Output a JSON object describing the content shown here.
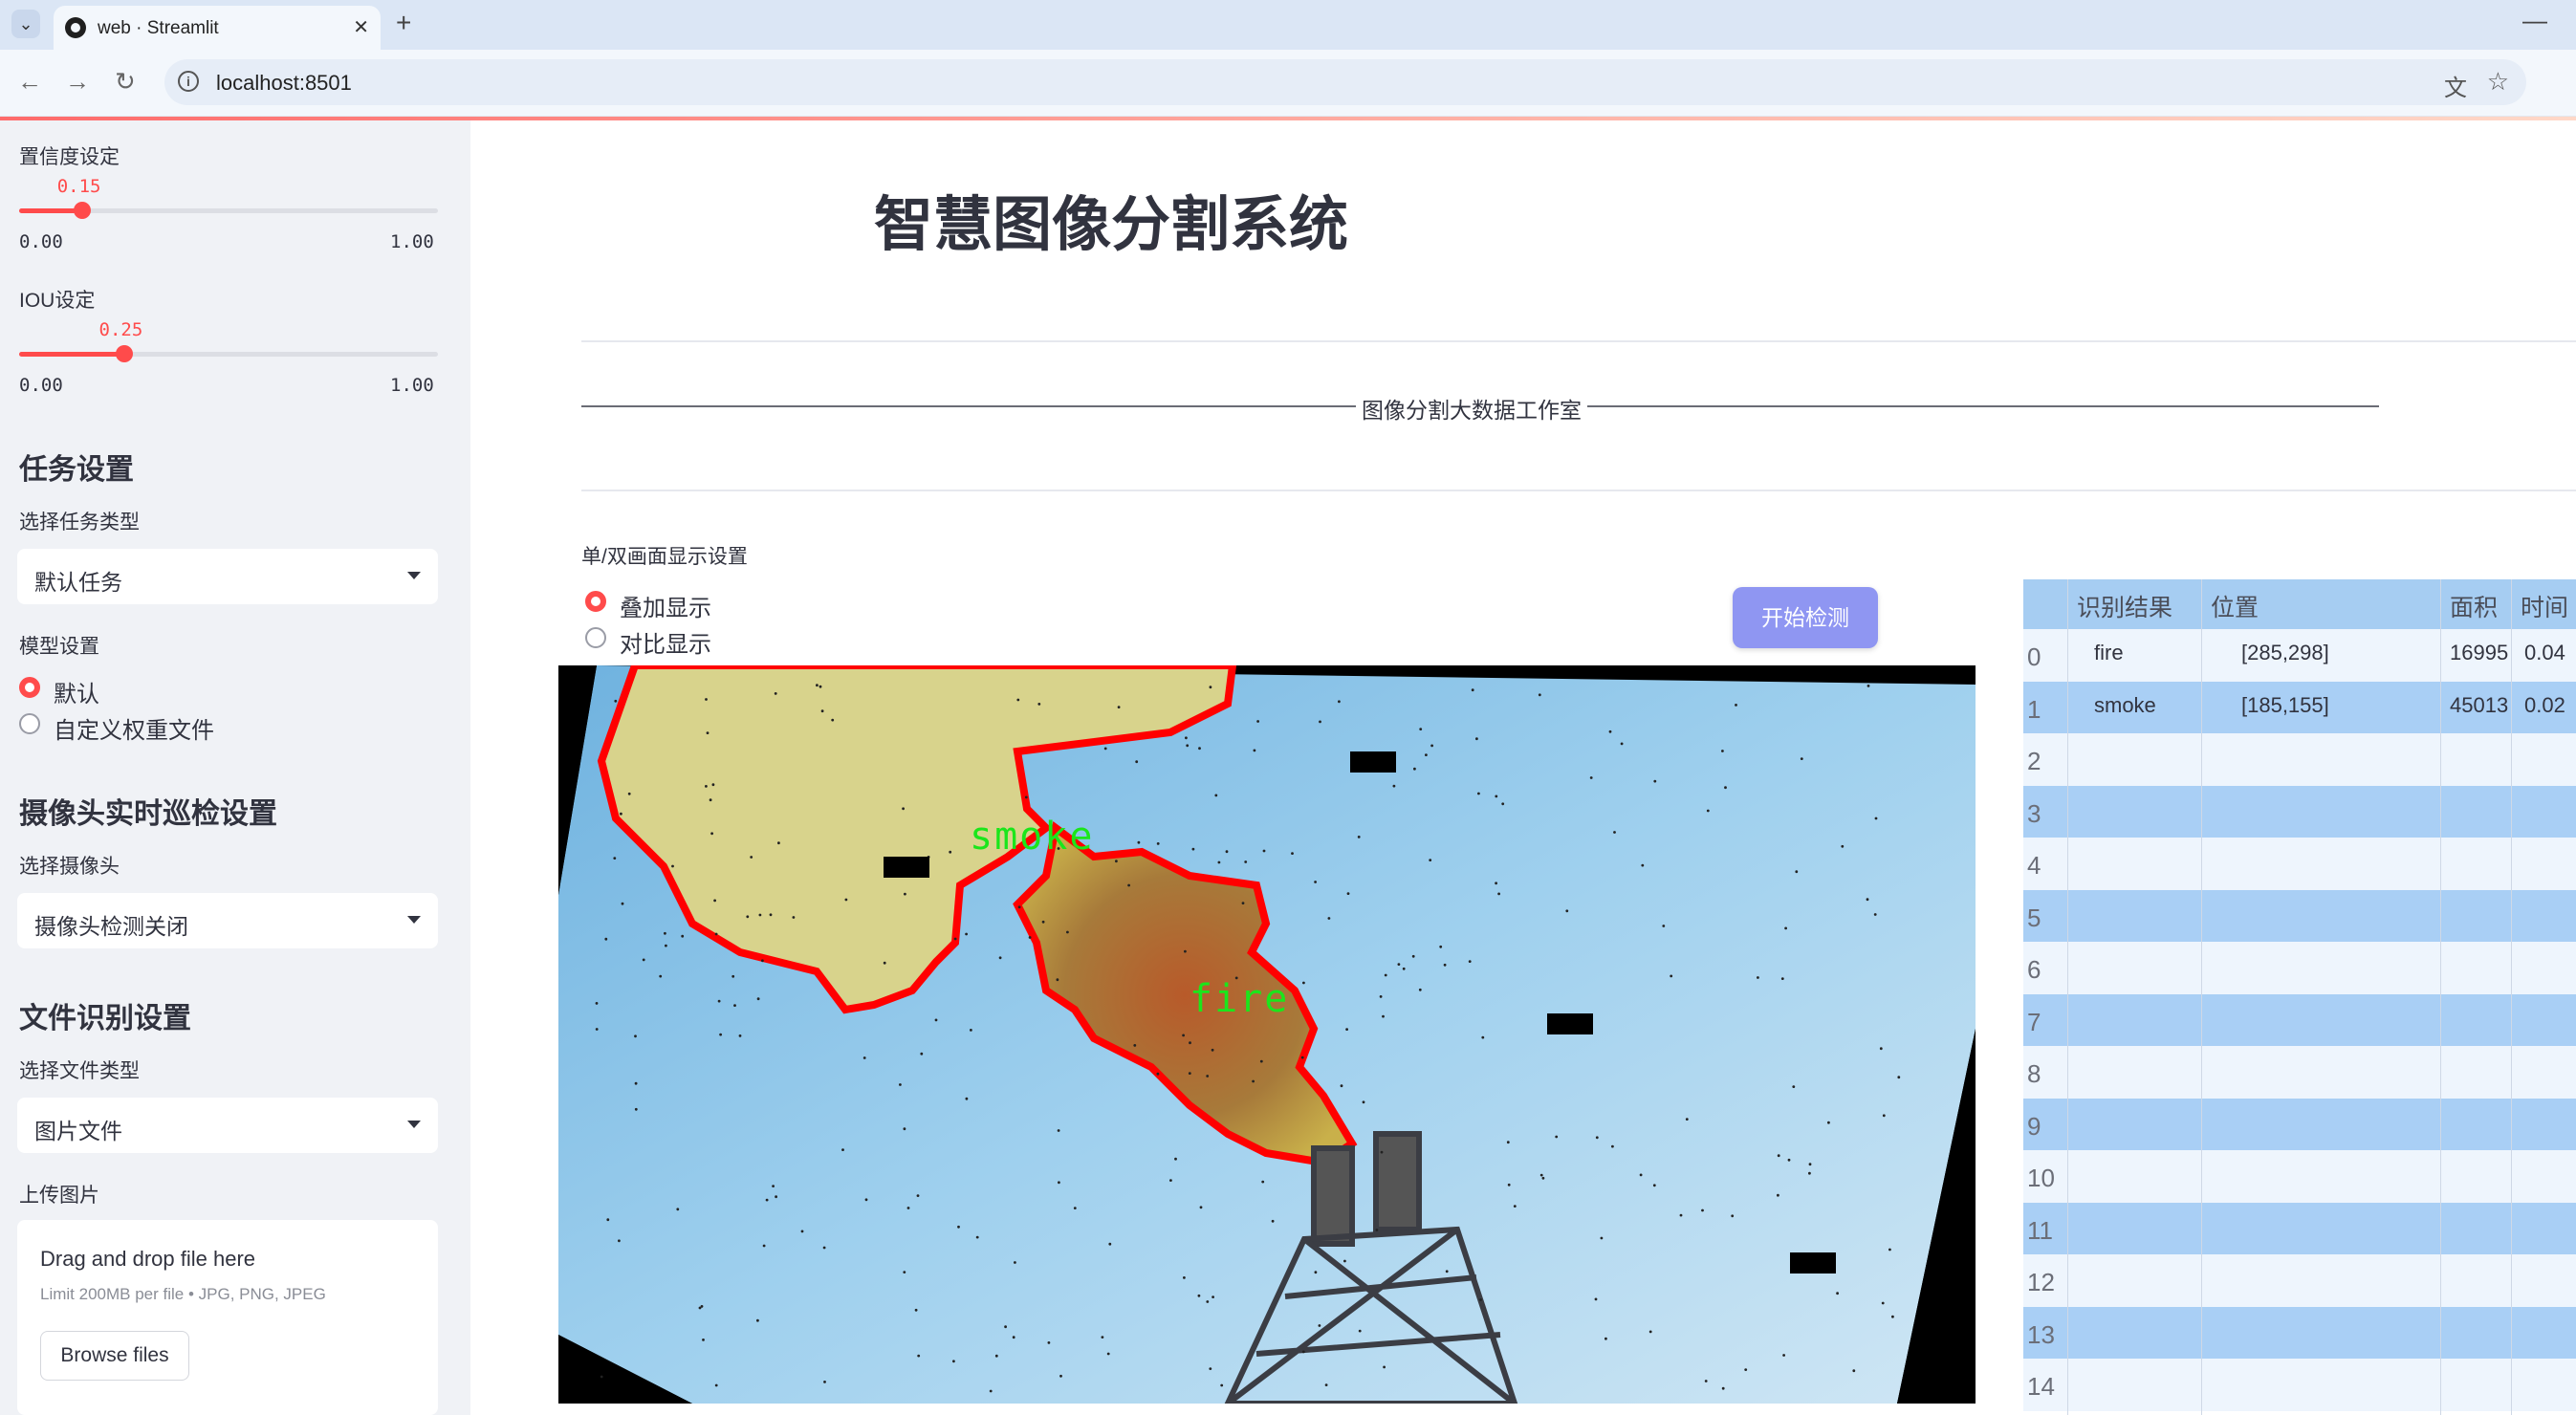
{
  "browser": {
    "tab_title": "web · Streamlit",
    "url": "localhost:8501",
    "new_tab": "+",
    "close": "✕",
    "minimize": "—"
  },
  "sidebar": {
    "confidence": {
      "label": "置信度设定",
      "value": "0.15",
      "min": "0.00",
      "max": "1.00",
      "fraction": 0.15
    },
    "iou": {
      "label": "IOU设定",
      "value": "0.25",
      "min": "0.00",
      "max": "1.00",
      "fraction": 0.25
    },
    "task_heading": "任务设置",
    "task_type_label": "选择任务类型",
    "task_type_value": "默认任务",
    "model_label": "模型设置",
    "model_options": [
      "默认",
      "自定义权重文件"
    ],
    "model_selected": 0,
    "camera_heading": "摄像头实时巡检设置",
    "camera_label": "选择摄像头",
    "camera_value": "摄像头检测关闭",
    "file_heading": "文件识别设置",
    "file_type_label": "选择文件类型",
    "file_type_value": "图片文件",
    "upload_label": "上传图片",
    "upload_title": "Drag and drop file here",
    "upload_limit": "Limit 200MB per file • JPG, PNG, JPEG",
    "upload_button": "Browse files"
  },
  "main": {
    "title": "智慧图像分割系统",
    "banner": "图像分割大数据工作室",
    "display_label": "单/双画面显示设置",
    "display_options": [
      "叠加显示",
      "对比显示"
    ],
    "display_selected": 0,
    "start_button": "开始检测",
    "segments": [
      {
        "label": "smoke",
        "color": "#1be61b"
      },
      {
        "label": "fire",
        "color": "#1be61b"
      }
    ]
  },
  "results_table": {
    "columns": [
      "识别结果",
      "位置",
      "面积",
      "时间"
    ],
    "rows": [
      {
        "index": "0",
        "result": "fire",
        "position": "[285,298]",
        "area": "16995",
        "time": "0.04"
      },
      {
        "index": "1",
        "result": "smoke",
        "position": "[185,155]",
        "area": "45013",
        "time": "0.02"
      },
      {
        "index": "2",
        "result": "",
        "position": "",
        "area": "",
        "time": ""
      },
      {
        "index": "3",
        "result": "",
        "position": "",
        "area": "",
        "time": ""
      },
      {
        "index": "4",
        "result": "",
        "position": "",
        "area": "",
        "time": ""
      },
      {
        "index": "5",
        "result": "",
        "position": "",
        "area": "",
        "time": ""
      },
      {
        "index": "6",
        "result": "",
        "position": "",
        "area": "",
        "time": ""
      },
      {
        "index": "7",
        "result": "",
        "position": "",
        "area": "",
        "time": ""
      },
      {
        "index": "8",
        "result": "",
        "position": "",
        "area": "",
        "time": ""
      },
      {
        "index": "9",
        "result": "",
        "position": "",
        "area": "",
        "time": ""
      },
      {
        "index": "10",
        "result": "",
        "position": "",
        "area": "",
        "time": ""
      },
      {
        "index": "11",
        "result": "",
        "position": "",
        "area": "",
        "time": ""
      },
      {
        "index": "12",
        "result": "",
        "position": "",
        "area": "",
        "time": ""
      },
      {
        "index": "13",
        "result": "",
        "position": "",
        "area": "",
        "time": ""
      },
      {
        "index": "14",
        "result": "",
        "position": "",
        "area": "",
        "time": ""
      }
    ]
  },
  "colors": {
    "accent": "#ff4b4b",
    "button": "#8f96f2",
    "mask_outline": "#ff0000",
    "sidebar_bg": "#f0f2f6"
  }
}
